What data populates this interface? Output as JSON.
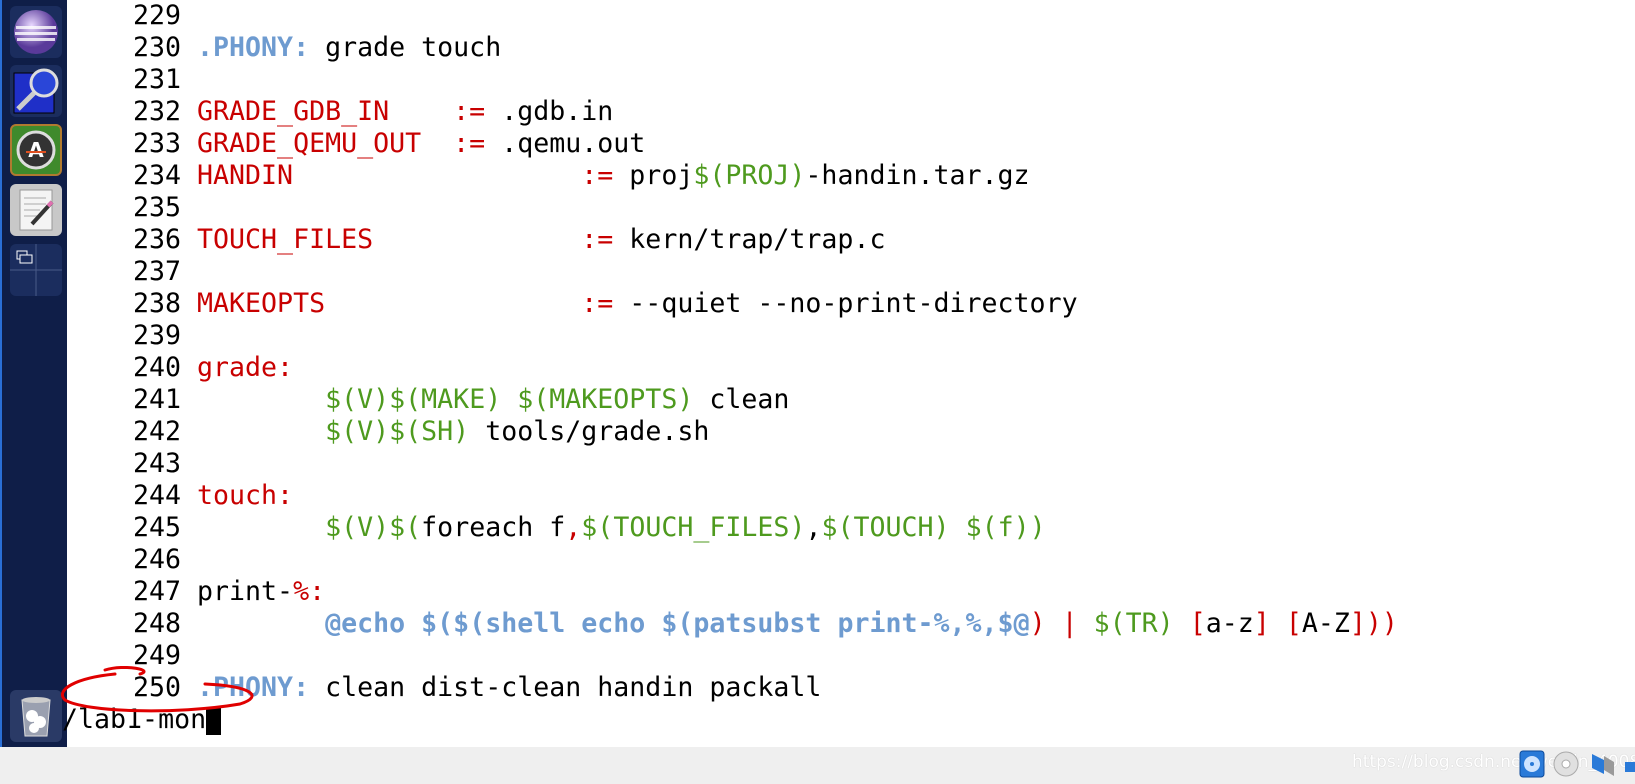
{
  "sidebar": {
    "launchers": [
      {
        "name": "eclipse-icon"
      },
      {
        "name": "search-tool-icon"
      },
      {
        "name": "update-manager-icon"
      },
      {
        "name": "text-editor-icon"
      },
      {
        "name": "workspace-switcher-icon"
      },
      {
        "name": "trash-icon"
      }
    ]
  },
  "colors": {
    "keyword_red": "#c80000",
    "target_blue": "#6e9bd0",
    "variable_green": "#4e9a1e",
    "annotation_red": "#e00000"
  },
  "editor": {
    "lines": [
      {
        "num": "229",
        "segs": []
      },
      {
        "num": "230",
        "segs": [
          [
            "b",
            ".PHONY:"
          ],
          [
            "k",
            " grade touch"
          ]
        ]
      },
      {
        "num": "231",
        "segs": []
      },
      {
        "num": "232",
        "segs": [
          [
            "r",
            "GRADE_GDB_IN    :="
          ],
          [
            "k",
            " .gdb.in"
          ]
        ]
      },
      {
        "num": "233",
        "segs": [
          [
            "r",
            "GRADE_QEMU_OUT  :="
          ],
          [
            "k",
            " .qemu.out"
          ]
        ]
      },
      {
        "num": "234",
        "segs": [
          [
            "r",
            "HANDIN                  :="
          ],
          [
            "k",
            " proj"
          ],
          [
            "g",
            "$(PROJ)"
          ],
          [
            "k",
            "-handin.tar.gz"
          ]
        ]
      },
      {
        "num": "235",
        "segs": []
      },
      {
        "num": "236",
        "segs": [
          [
            "r",
            "TOUCH_FILES             :="
          ],
          [
            "k",
            " kern/trap/trap.c"
          ]
        ]
      },
      {
        "num": "237",
        "segs": []
      },
      {
        "num": "238",
        "segs": [
          [
            "r",
            "MAKEOPTS                :="
          ],
          [
            "k",
            " --quiet --no-print-directory"
          ]
        ]
      },
      {
        "num": "239",
        "segs": []
      },
      {
        "num": "240",
        "segs": [
          [
            "r",
            "grade:"
          ]
        ]
      },
      {
        "num": "241",
        "segs": [
          [
            "k",
            "        "
          ],
          [
            "g",
            "$(V)$(MAKE) $(MAKEOPTS)"
          ],
          [
            "k",
            " clean"
          ]
        ]
      },
      {
        "num": "242",
        "segs": [
          [
            "k",
            "        "
          ],
          [
            "g",
            "$(V)$(SH)"
          ],
          [
            "k",
            " tools/grade.sh"
          ]
        ]
      },
      {
        "num": "243",
        "segs": []
      },
      {
        "num": "244",
        "segs": [
          [
            "r",
            "touch:"
          ]
        ]
      },
      {
        "num": "245",
        "segs": [
          [
            "k",
            "        "
          ],
          [
            "g",
            "$(V)$("
          ],
          [
            "k",
            "foreach f"
          ],
          [
            "r",
            ","
          ],
          [
            "g",
            "$(TOUCH_FILES)"
          ],
          [
            "k",
            ","
          ],
          [
            "g",
            "$(TOUCH) $(f))"
          ]
        ]
      },
      {
        "num": "246",
        "segs": []
      },
      {
        "num": "247",
        "segs": [
          [
            "k",
            "print-"
          ],
          [
            "r",
            "%:"
          ]
        ]
      },
      {
        "num": "248",
        "segs": [
          [
            "k",
            "        "
          ],
          [
            "b",
            "@echo $($(shell echo $(patsubst print-%,%,$@"
          ],
          [
            "r",
            ")"
          ],
          [
            "k",
            " "
          ],
          [
            "r",
            "|"
          ],
          [
            "k",
            " "
          ],
          [
            "g",
            "$(TR)"
          ],
          [
            "k",
            " "
          ],
          [
            "r",
            "["
          ],
          [
            "k",
            "a-z"
          ],
          [
            "r",
            "]"
          ],
          [
            "k",
            " "
          ],
          [
            "r",
            "["
          ],
          [
            "k",
            "A-Z"
          ],
          [
            "r",
            "]))"
          ]
        ]
      },
      {
        "num": "249",
        "segs": []
      },
      {
        "num": "250",
        "segs": [
          [
            "b",
            ".PHONY:"
          ],
          [
            "k",
            " clean dist-clean handin packall"
          ]
        ]
      }
    ],
    "command_line": "/lab1-mon"
  },
  "statusbar": {
    "watermark": "https://blog.csdn.net/weixin_40085",
    "icons": [
      "hard-disk-icon",
      "optical-drive-icon",
      "audio-icon",
      "network-icon",
      "display-icon"
    ]
  }
}
